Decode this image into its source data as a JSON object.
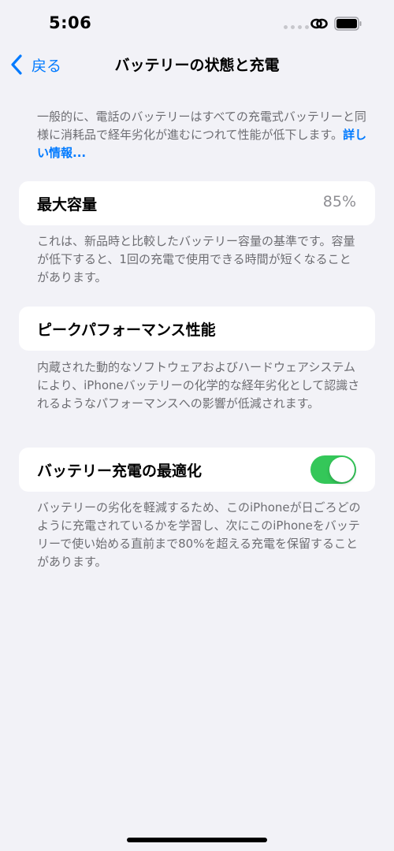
{
  "status_bar": {
    "time": "5:06",
    "icons": [
      "signal-dots-icon",
      "link-icon",
      "battery-icon"
    ]
  },
  "nav": {
    "back_label": "戻る",
    "title": "バッテリーの状態と充電"
  },
  "intro": {
    "text": "一般的に、電話のバッテリーはすべての充電式バッテリーと同様に消耗品で経年劣化が進むにつれて性能が低下します。",
    "link": "詳しい情報..."
  },
  "max_capacity": {
    "label": "最大容量",
    "value": "85%",
    "footnote": "これは、新品時と比較したバッテリー容量の基準です。容量が低下すると、1回の充電で使用できる時間が短くなることがあります。"
  },
  "peak_performance": {
    "label": "ピークパフォーマンス性能",
    "footnote": "内蔵された動的なソフトウェアおよびハードウェアシステムにより、iPhoneバッテリーの化学的な経年劣化として認識されるようなパフォーマンスへの影響が低減されます。"
  },
  "optimized_charging": {
    "label": "バッテリー充電の最適化",
    "enabled": true,
    "footnote": "バッテリーの劣化を軽減するため、このiPhoneが日ごろどのように充電されているかを学習し、次にこのiPhoneをバッテリーで使い始める直前まで80%を超える充電を保留することがあります。"
  },
  "colors": {
    "background": "#f2f2f7",
    "accent": "#007aff",
    "toggle_on": "#34c759",
    "secondary_text": "#6d6d72"
  }
}
